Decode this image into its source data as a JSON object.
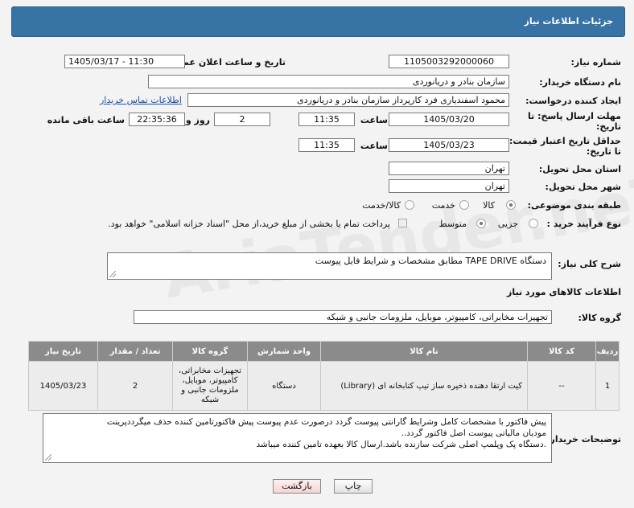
{
  "header": {
    "title": "جزئیات اطلاعات نیاز"
  },
  "fields": {
    "need_number_label": "شماره نیاز:",
    "need_number": "1105003292000060",
    "announce_label": "تاریخ و ساعت اعلان عمومی:",
    "announce_value": "1405/03/17 - 11:30",
    "buyer_org_label": "نام دستگاه خریدار:",
    "buyer_org": "سازمان بنادر و دریانوردی",
    "creator_label": "ایجاد کننده درخواست:",
    "creator": "محمود اسفندیاری فرد کارپرداز سازمان بنادر و دریانوردی",
    "contact_link": "اطلاعات تماس خریدار",
    "deadline_label_1": "مهلت ارسال پاسخ: تا",
    "deadline_label_2": "تاریخ:",
    "deadline_date": "1405/03/20",
    "time_label": "ساعت",
    "deadline_time": "11:35",
    "days_value": "2",
    "days_label": "روز و",
    "remaining_time": "22:35:36",
    "remaining_label": "ساعت باقی مانده",
    "validity_label_1": "حداقل تاریخ اعتبار قیمت:",
    "validity_label_2": "تا تاریخ:",
    "validity_date": "1405/03/23",
    "validity_time": "11:35",
    "province_label": "استان محل تحویل:",
    "province": "تهران",
    "city_label": "شهر محل تحویل:",
    "city": "تهران",
    "category_label": "طبقه بندی موضوعی:",
    "category_options": [
      "کالا",
      "خدمت",
      "کالا/خدمت"
    ],
    "category_selected": "کالا",
    "process_label": "نوع فرآیند خرید :",
    "process_options": [
      "جزیی",
      "متوسط"
    ],
    "process_selected": "متوسط",
    "payment_note": "پرداخت تمام یا بخشی از مبلغ خرید،از محل \"اسناد خزانه اسلامی\" خواهد بود.",
    "description_label": "شرح کلی نیاز:",
    "description": "دستگاه TAPE DRIVE مطابق مشخصات و شرایط فایل پیوست"
  },
  "goods": {
    "section_title": "اطلاعات کالاهای مورد نیاز",
    "group_label": "گروه کالا:",
    "group_value": "تجهیزات مخابراتی، کامپیوتر، موبایل، ملزومات جانبی و شبکه",
    "columns": [
      "ردیف",
      "کد کالا",
      "نام کالا",
      "واحد شمارش",
      "گروه کالا",
      "تعداد / مقدار",
      "تاریخ نیاز"
    ],
    "rows": [
      [
        "1",
        "--",
        "کیت ارتقا دهنده ذخیره ساز تیپ کتابخانه ای (Library)",
        "دستگاه",
        "تجهیزات مخابراتی، کامپیوتر، موبایل، ملزومات جانبی و شبکه",
        "2",
        "1405/03/23"
      ]
    ]
  },
  "buyer_notes": {
    "label": "توضیحات خریدار:",
    "lines": [
      "پیش فاکتور با مشخصات کامل وشرایط گارانتی پیوست گردد درصورت عدم پیوست پیش فاکتورتامین کننده حذف میگرددپرینت",
      "مودیان مالیاتی پیوست اصل فاکتور گردد..",
      ".دستگاه پک وپلمپ اصلی شرکت سازنده باشد.ارسال کالا بعهده تامین کننده میباشد"
    ]
  },
  "buttons": {
    "print": "چاپ",
    "back": "بازگشت"
  },
  "colors": {
    "header_bg": "#3873a6",
    "table_header_bg": "#8b8b8b",
    "link": "#1a52a8",
    "back_button_bg": "#fbe4e4"
  }
}
